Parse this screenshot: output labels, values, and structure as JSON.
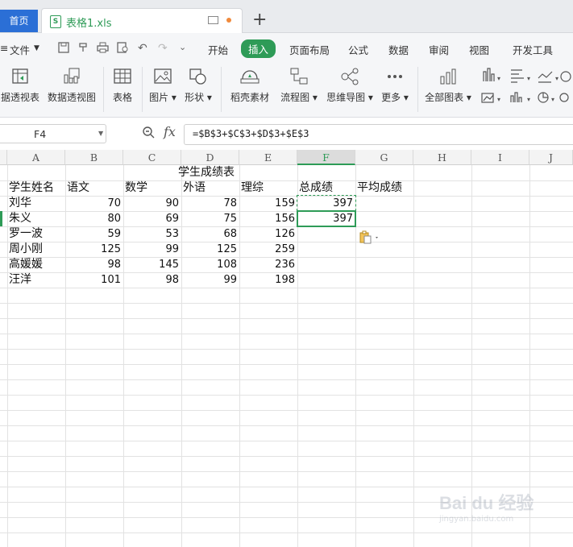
{
  "tabs": {
    "home": "首页",
    "file": "表格1.xls",
    "new_tab": "+"
  },
  "menu": {
    "file": "文件",
    "items": [
      "开始",
      "插入",
      "页面布局",
      "公式",
      "数据",
      "审阅",
      "视图",
      "开发工具"
    ],
    "active": "插入"
  },
  "ribbon": [
    {
      "label": "据透视表",
      "icon": "pivot-table-icon"
    },
    {
      "label": "数据透视图",
      "icon": "pivot-chart-icon"
    },
    {
      "label": "表格",
      "icon": "table-icon"
    },
    {
      "label": "图片",
      "icon": "picture-icon"
    },
    {
      "label": "形状",
      "icon": "shape-icon"
    },
    {
      "label": "稻壳素材",
      "icon": "docer-material-icon"
    },
    {
      "label": "流程图",
      "icon": "flowchart-icon"
    },
    {
      "label": "思维导图",
      "icon": "mindmap-icon"
    },
    {
      "label": "更多",
      "icon": "more-icon"
    },
    {
      "label": "全部图表",
      "icon": "all-charts-icon"
    }
  ],
  "formula_bar": {
    "name_box": "F4",
    "fx": "fx",
    "formula": "=$B$3+$C$3+$D$3+$E$3"
  },
  "columns": [
    "A",
    "B",
    "C",
    "D",
    "E",
    "F",
    "G",
    "H",
    "I",
    "J"
  ],
  "selected_column": "F",
  "sheet": {
    "title": "学生成绩表",
    "headers": [
      "学生姓名",
      "语文",
      "数学",
      "外语",
      "理综",
      "总成绩",
      "平均成绩"
    ],
    "rows": [
      {
        "name": "刘华",
        "chinese": "70",
        "math": "90",
        "english": "78",
        "science": "159",
        "total": "397"
      },
      {
        "name": "朱义",
        "chinese": "80",
        "math": "69",
        "english": "75",
        "science": "156",
        "total": "397"
      },
      {
        "name": "罗一波",
        "chinese": "59",
        "math": "53",
        "english": "68",
        "science": "126",
        "total": ""
      },
      {
        "name": "周小刚",
        "chinese": "125",
        "math": "99",
        "english": "125",
        "science": "259",
        "total": ""
      },
      {
        "name": "高媛媛",
        "chinese": "98",
        "math": "145",
        "english": "108",
        "science": "236",
        "total": ""
      },
      {
        "name": "汪洋",
        "chinese": "101",
        "math": "98",
        "english": "99",
        "science": "198",
        "total": ""
      }
    ]
  },
  "watermark": {
    "brand": "Bai du 经验",
    "url": "jingyan.baidu.com"
  },
  "colors": {
    "accent": "#2e9b57",
    "home_tab": "#2b6fd6"
  }
}
